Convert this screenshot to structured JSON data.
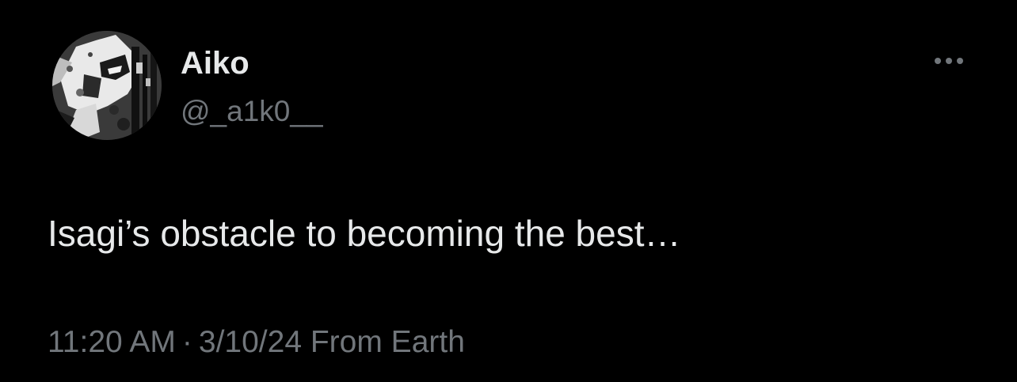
{
  "tweet": {
    "author": {
      "display_name": "Aiko",
      "handle": "@_a1k0__",
      "avatar_icon": "profile-avatar-manga-art"
    },
    "text": "Isagi’s obstacle to becoming the best…",
    "time": "11:20 AM",
    "separator": "·",
    "date": "3/10/24",
    "source": "From Earth",
    "more_icon": "more-options-icon"
  },
  "colors": {
    "background": "#000000",
    "primary_text": "#e7e9ea",
    "secondary_text": "#71767b"
  }
}
